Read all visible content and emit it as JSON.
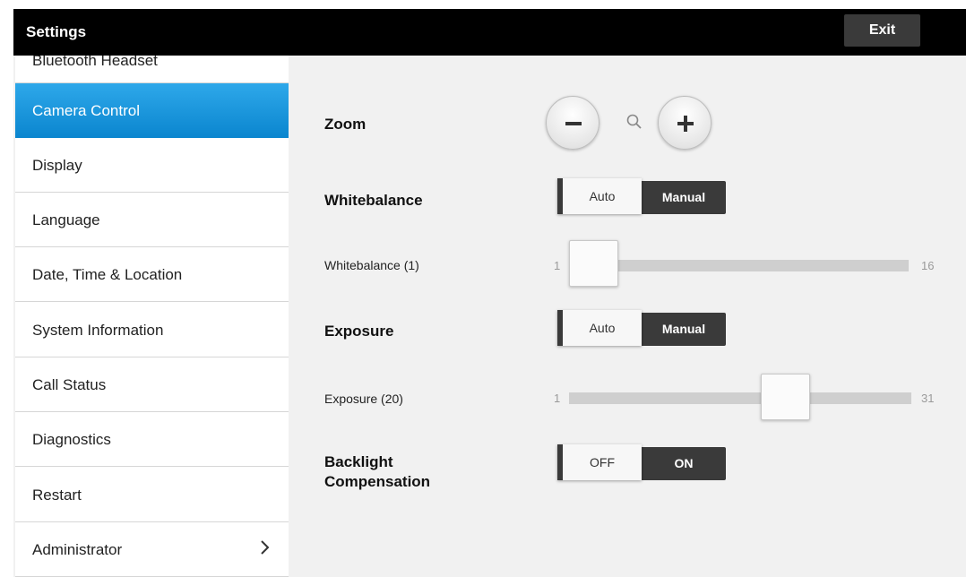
{
  "titlebar": {
    "title": "Settings",
    "exit_label": "Exit"
  },
  "sidebar": {
    "items": [
      {
        "label": "Bluetooth Headset"
      },
      {
        "label": "Camera Control"
      },
      {
        "label": "Display"
      },
      {
        "label": "Language"
      },
      {
        "label": "Date, Time & Location"
      },
      {
        "label": "System Information"
      },
      {
        "label": "Call Status"
      },
      {
        "label": "Diagnostics"
      },
      {
        "label": "Restart"
      },
      {
        "label": "Administrator"
      }
    ],
    "selected": "Camera Control"
  },
  "camera": {
    "zoom": {
      "label": "Zoom",
      "minus_icon": "minus-icon",
      "plus_icon": "plus-icon",
      "search_icon": "search-icon"
    },
    "whitebalance": {
      "label": "Whitebalance",
      "options": [
        "Auto",
        "Manual"
      ],
      "selected": "Auto",
      "slider_label": "Whitebalance (1)",
      "min": "1",
      "max": "16",
      "value": 1
    },
    "exposure": {
      "label": "Exposure",
      "options": [
        "Auto",
        "Manual"
      ],
      "selected": "Auto",
      "slider_label": "Exposure (20)",
      "min": "1",
      "max": "31",
      "value": 20
    },
    "backlight": {
      "label_line1": "Backlight",
      "label_line2": "Compensation",
      "options": [
        "OFF",
        "ON"
      ],
      "selected": "OFF"
    }
  },
  "colors": {
    "accent": "#0b86cf",
    "titlebar": "#000000",
    "toggle_dark": "#3a3a3a"
  }
}
